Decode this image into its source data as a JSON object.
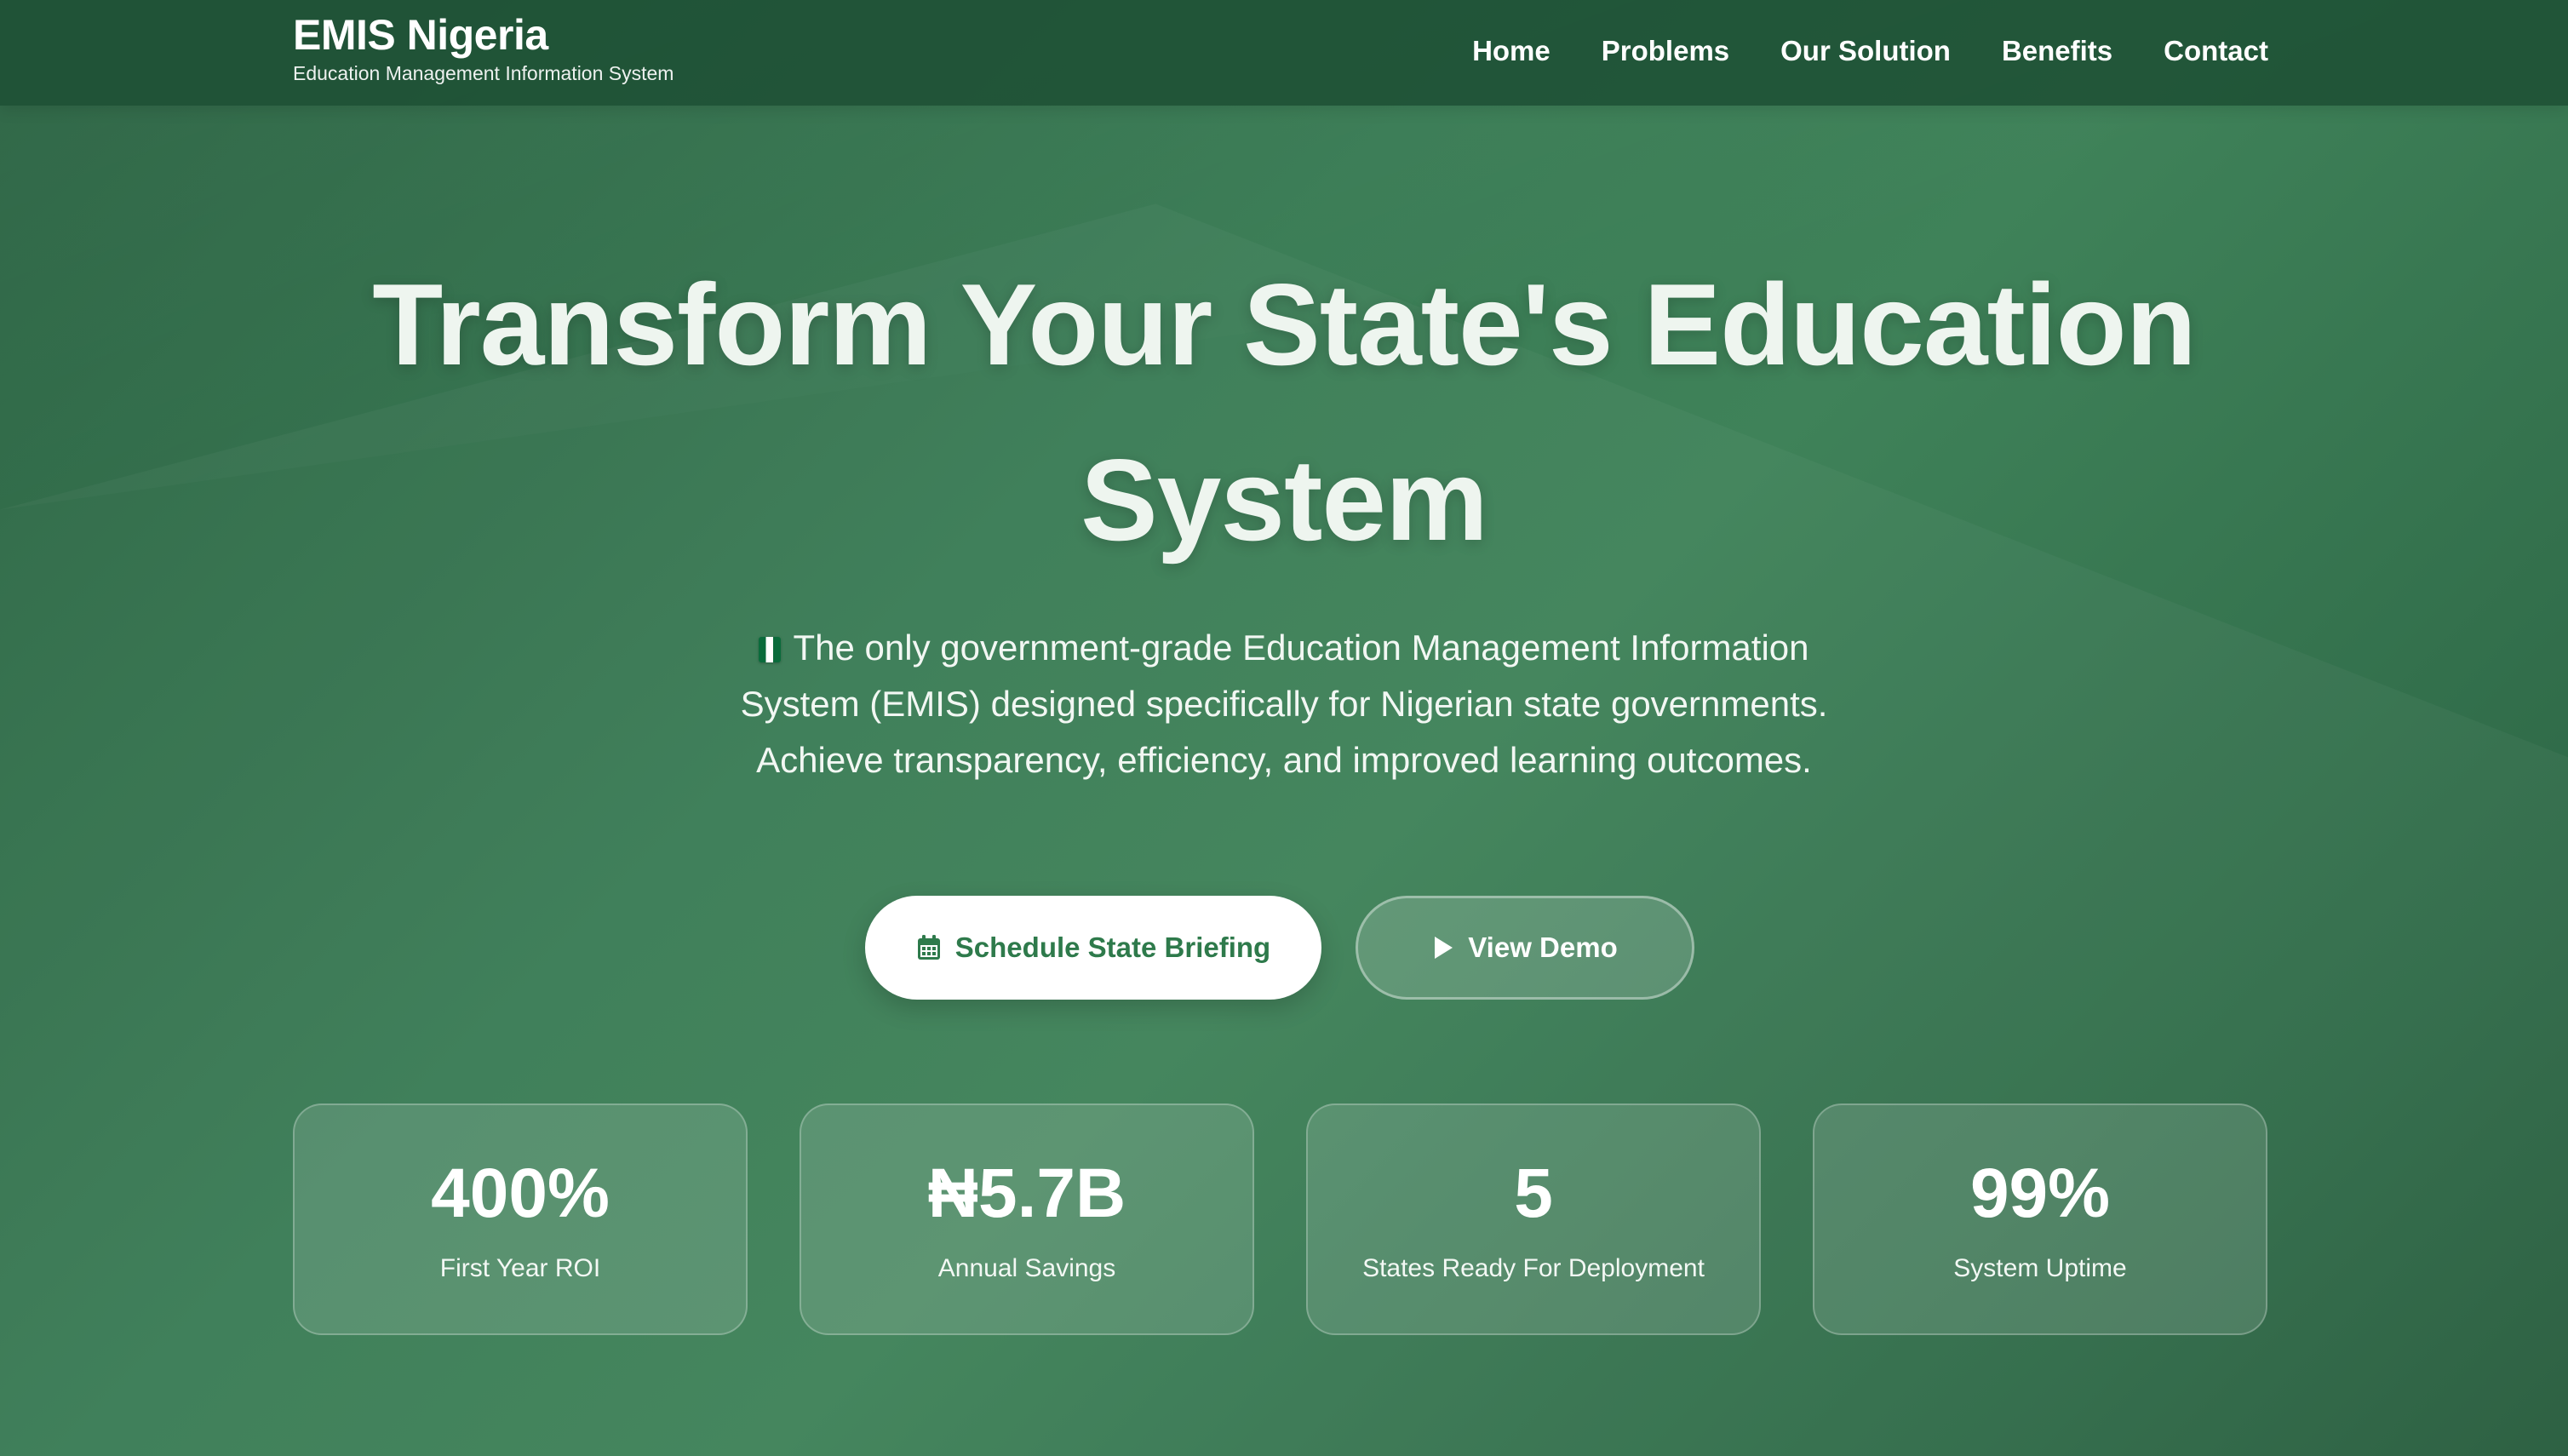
{
  "navbar": {
    "brand_title": "EMIS Nigeria",
    "brand_subtitle": "Education Management Information System",
    "links": [
      "Home",
      "Problems",
      "Our Solution",
      "Benefits",
      "Contact"
    ]
  },
  "hero": {
    "title_line1": "Transform Your State's Education",
    "title_line2": "System",
    "description_flag_icon": "nigeria-flag-icon",
    "description": "The only government-grade Education Management Information System (EMIS) designed specifically for Nigerian state governments. Achieve transparency, efficiency, and improved learning outcomes.",
    "primary_button": {
      "label": "Schedule State Briefing",
      "icon": "calendar-icon"
    },
    "secondary_button": {
      "label": "View Demo",
      "icon": "play-icon"
    }
  },
  "stats": [
    {
      "value": "400%",
      "label": "First Year ROI"
    },
    {
      "value": "₦5.7B",
      "label": "Annual Savings"
    },
    {
      "value": "5",
      "label": "States Ready For Deployment"
    },
    {
      "value": "99%",
      "label": "System Uptime"
    }
  ],
  "colors": {
    "brand_green": "#2e7a4b",
    "nav_background": "#1e5034",
    "background_light": "#3f8259",
    "background_dark": "#27603f"
  }
}
